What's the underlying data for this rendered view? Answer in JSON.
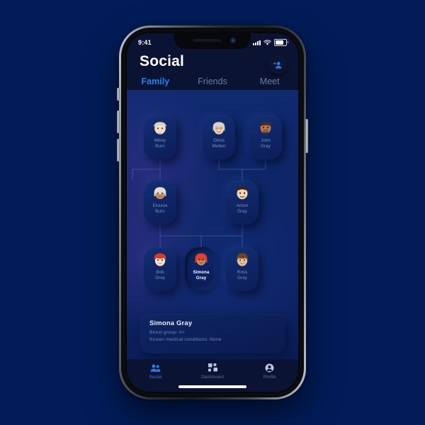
{
  "statusbar": {
    "time": "9:41",
    "signal_icon": "cellular-signal-icon",
    "wifi_icon": "wifi-icon",
    "battery_icon": "battery-icon"
  },
  "header": {
    "title": "Social",
    "add_person_icon": "add-person-icon",
    "tabs": [
      {
        "label": "Family",
        "active": true
      },
      {
        "label": "Friends",
        "active": false
      },
      {
        "label": "Meet",
        "active": false
      }
    ]
  },
  "tree": {
    "people": [
      {
        "id": "mikey",
        "first": "Mikey",
        "last": "Burn",
        "selected": false,
        "skin": "#F3DCC4",
        "hair": "#D9D4CB",
        "hair_style": "bald-sides",
        "facial": "mustache-white",
        "glasses": false
      },
      {
        "id": "olivia",
        "first": "Olivia",
        "last": "Mullen",
        "selected": false,
        "skin": "#F0D7BE",
        "hair": "#D8D3CA",
        "hair_style": "long-grey",
        "facial": "none",
        "glasses": true
      },
      {
        "id": "john",
        "first": "John",
        "last": "Gray",
        "selected": false,
        "skin": "#B5764C",
        "hair": "#4A2F1E",
        "hair_style": "short-dark",
        "facial": "beard-dark",
        "glasses": false
      },
      {
        "id": "elouise",
        "first": "Elouise",
        "last": "Burn",
        "selected": false,
        "skin": "#C98F62",
        "hair": "#E2DDD4",
        "hair_style": "long-grey",
        "facial": "none",
        "glasses": false
      },
      {
        "id": "anton",
        "first": "Anton",
        "last": "Gray",
        "selected": false,
        "skin": "#F2D3B3",
        "hair": "#3B2415",
        "hair_style": "short-dark",
        "facial": "mustache-dark",
        "glasses": false
      },
      {
        "id": "bob",
        "first": "Bob",
        "last": "Gray",
        "selected": false,
        "skin": "#F7E0C8",
        "hair": "#D8392B",
        "hair_style": "red-bowl",
        "facial": "none",
        "glasses": false
      },
      {
        "id": "simona",
        "first": "Simona",
        "last": "Gray",
        "selected": true,
        "skin": "#C98A5A",
        "hair": "#E0402E",
        "hair_style": "red-long",
        "facial": "none",
        "glasses": false
      },
      {
        "id": "ross",
        "first": "Ross",
        "last": "Gray",
        "selected": false,
        "skin": "#E8BE94",
        "hair": "#6B4523",
        "hair_style": "brown-short",
        "facial": "none",
        "glasses": false
      }
    ]
  },
  "info_card": {
    "name": "Simona Gray",
    "blood_group": "Blood group: A+",
    "conditions": "Known medical conditions: None"
  },
  "bottom_nav": [
    {
      "label": "Social",
      "icon": "people-icon",
      "active": true
    },
    {
      "label": "Dashboard",
      "icon": "grid-icon",
      "active": false
    },
    {
      "label": "Profile",
      "icon": "person-icon",
      "active": false
    }
  ],
  "colors": {
    "page_background": "#011C58",
    "screen_background": "#0B1333",
    "accent_blue": "#2A7FEF",
    "muted_text": "#6A7BA5"
  }
}
